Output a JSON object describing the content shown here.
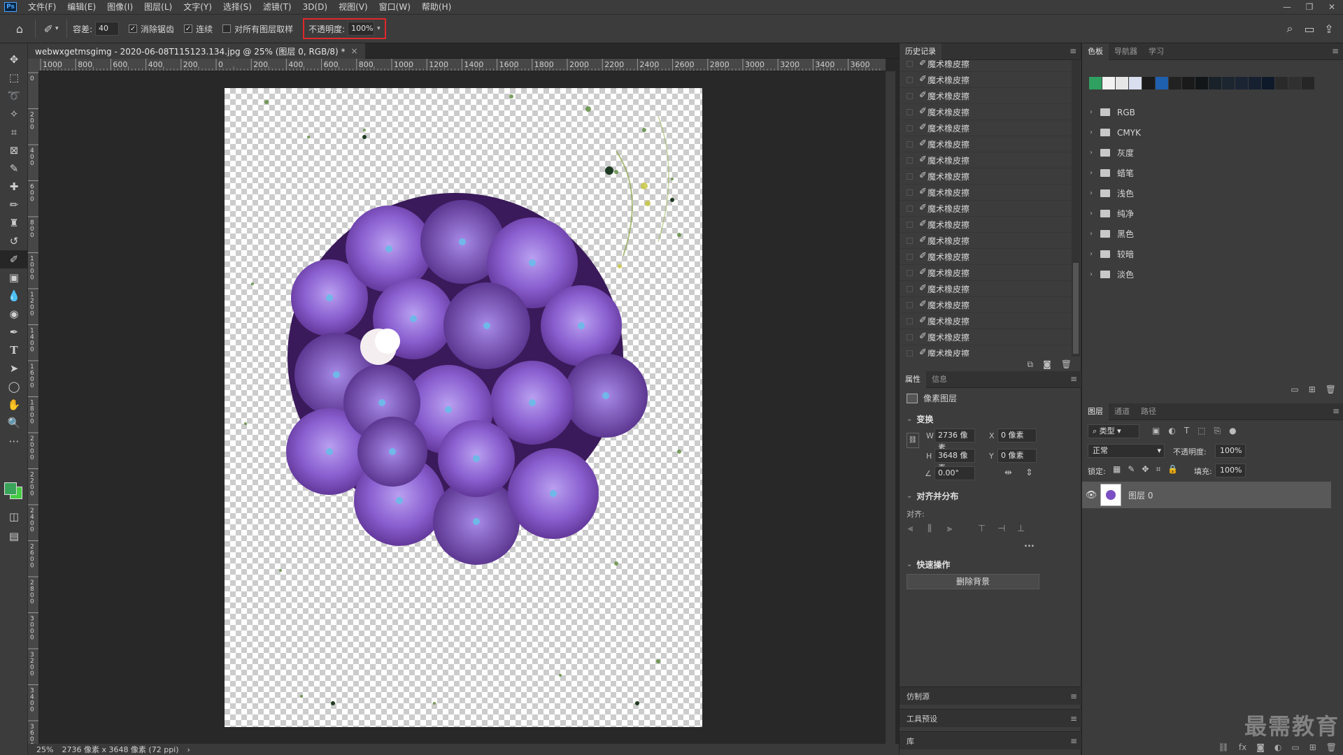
{
  "app": {
    "logo": "Ps"
  },
  "menu": [
    "文件(F)",
    "编辑(E)",
    "图像(I)",
    "图层(L)",
    "文字(Y)",
    "选择(S)",
    "滤镜(T)",
    "3D(D)",
    "视图(V)",
    "窗口(W)",
    "帮助(H)"
  ],
  "window_controls": {
    "minimize": "—",
    "restore": "❐",
    "close": "✕"
  },
  "options": {
    "tolerance_label": "容差:",
    "tolerance_value": "40",
    "antialias_label": "消除锯齿",
    "antialias_checked": true,
    "contiguous_label": "连续",
    "contiguous_checked": true,
    "sample_all_label": "对所有图层取样",
    "sample_all_checked": false,
    "opacity_label": "不透明度:",
    "opacity_value": "100%"
  },
  "document": {
    "tab_title": "webwxgetmsgimg - 2020-06-08T115123.134.jpg @ 25% (图层 0, RGB/8) *",
    "ruler_h_labels": [
      "1000",
      "800",
      "600",
      "400",
      "200",
      "0",
      "200",
      "400",
      "600",
      "800",
      "1000",
      "1200",
      "1400",
      "1600",
      "1800",
      "2000",
      "2200",
      "2400",
      "2600",
      "2800",
      "3000",
      "3200",
      "3400",
      "3600"
    ],
    "ruler_v_labels": [
      "0",
      "2 0 0",
      "4 0 0",
      "6 0 0",
      "8 0 0",
      "1 0 0 0",
      "1 2 0 0",
      "1 4 0 0",
      "1 6 0 0",
      "1 8 0 0",
      "2 0 0 0",
      "2 2 0 0",
      "2 4 0 0",
      "2 6 0 0",
      "2 8 0 0",
      "3 0 0 0",
      "3 2 0 0",
      "3 4 0 0",
      "3 6 0 0"
    ]
  },
  "status": {
    "zoom": "25%",
    "doc_info": "2736 像素 x 3648 像素 (72 ppi)",
    "arrow": "›"
  },
  "history": {
    "tab": "历史记录",
    "items": [
      "魔术橡皮擦",
      "魔术橡皮擦",
      "魔术橡皮擦",
      "魔术橡皮擦",
      "魔术橡皮擦",
      "魔术橡皮擦",
      "魔术橡皮擦",
      "魔术橡皮擦",
      "魔术橡皮擦",
      "魔术橡皮擦",
      "魔术橡皮擦",
      "魔术橡皮擦",
      "魔术橡皮擦",
      "魔术橡皮擦",
      "魔术橡皮擦",
      "魔术橡皮擦",
      "魔术橡皮擦",
      "魔术橡皮擦",
      "魔术橡皮擦",
      "魔术橡皮擦"
    ]
  },
  "properties": {
    "tabs": [
      "属性",
      "信息"
    ],
    "layer_type": "像素图层",
    "transform_title": "变换",
    "w_label": "W",
    "w_value": "2736 像素",
    "h_label": "H",
    "h_value": "3648 像素",
    "x_label": "X",
    "x_value": "0 像素",
    "y_label": "Y",
    "y_value": "0 像素",
    "angle_value": "0.00°",
    "align_title": "对齐并分布",
    "align_label": "对齐:",
    "more": "...",
    "quick_title": "快速操作",
    "remove_bg": "删除背景"
  },
  "collapsed_panels": [
    "仿制源",
    "工具预设",
    "库"
  ],
  "swatches": {
    "tabs": [
      "色板",
      "导航器",
      "学习"
    ],
    "colors": [
      "#2fa060",
      "#f2f2f2",
      "#e6e6e6",
      "#d9dfef",
      "#1b1b1b",
      "#1e5fae",
      "#222222",
      "#1a1a1a",
      "#121619",
      "#1a2229",
      "#1c2630",
      "#1a2433",
      "#162030",
      "#0e1a2a",
      "#2a2a2a",
      "#303030",
      "#262626"
    ],
    "groups": [
      "RGB",
      "CMYK",
      "灰度",
      "蜡笔",
      "浅色",
      "纯净",
      "黑色",
      "较暗",
      "淡色"
    ]
  },
  "layers": {
    "tabs": [
      "图层",
      "通道",
      "路径"
    ],
    "filter_label": "类型",
    "blend_mode": "正常",
    "opacity_label": "不透明度:",
    "opacity_value": "100%",
    "lock_label": "锁定:",
    "fill_label": "填充:",
    "fill_value": "100%",
    "layer_name": "图层 0"
  },
  "watermark": "最需教育"
}
